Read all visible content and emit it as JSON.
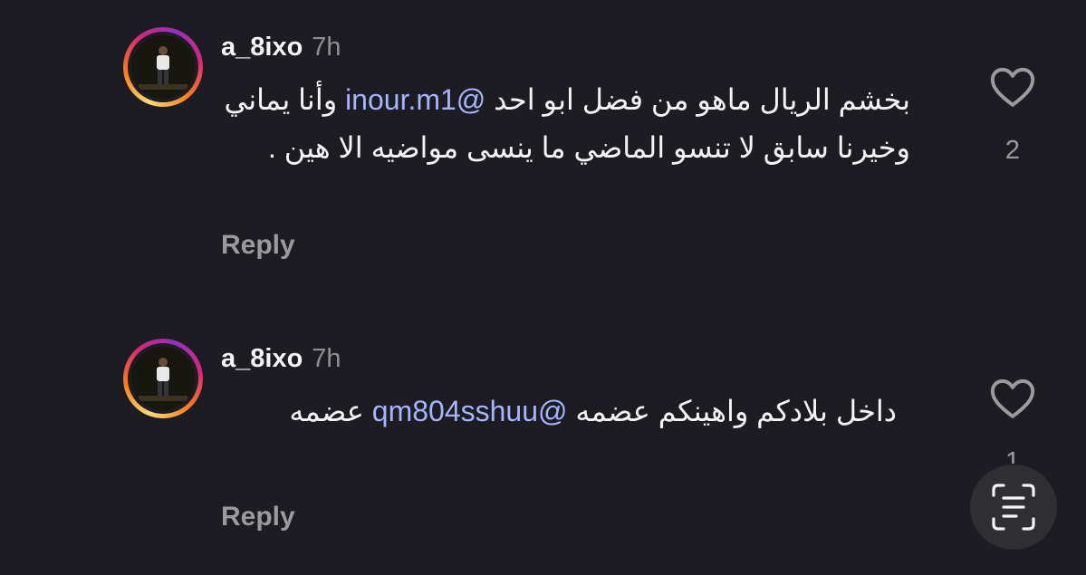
{
  "comments": [
    {
      "username": "a_8ixo",
      "time": "7h",
      "mention": "@inour.m1",
      "text_line1": "بخشم الريال ماهو من فضل ابو احد",
      "text_rest": "وأنا يماني وخيرنا سابق لا تنسو الماضي ما ينسى مواضيه الا هين .",
      "reply_label": "Reply",
      "like_count": "2"
    },
    {
      "username": "a_8ixo",
      "time": "7h",
      "mention": "@qm804sshuu",
      "text_line1": "داخل بلادكم واهينكم عضمه",
      "text_rest": "عضمه",
      "reply_label": "Reply",
      "like_count": "1"
    }
  ],
  "icons": {
    "like": "heart-outline-icon",
    "scan": "live-text-scan-icon"
  },
  "colors": {
    "background": "#1c1c22",
    "mention": "#a5b4fc",
    "secondary_text": "#9a9a9f"
  }
}
